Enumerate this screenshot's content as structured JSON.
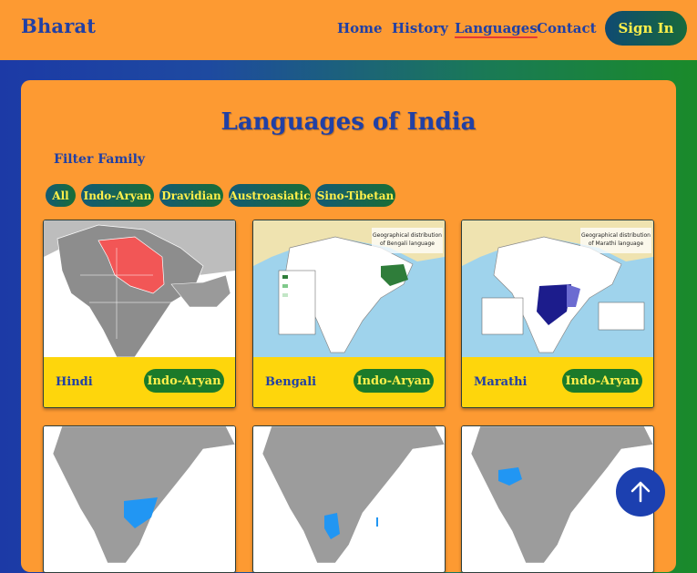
{
  "header": {
    "brand": "Bharat",
    "nav": [
      "Home",
      "History",
      "Languages",
      "Contact"
    ],
    "active_nav": "Languages",
    "sign_in": "Sign In"
  },
  "page": {
    "title": "Languages of India",
    "filter_label": "Filter Family",
    "filters": [
      "All",
      "Indo-Aryan",
      "Dravidian",
      "Austroasiatic",
      "Sino-Tibetan"
    ]
  },
  "cards": [
    {
      "name": "Hindi",
      "family": "Indo-Aryan",
      "map_caption": ""
    },
    {
      "name": "Bengali",
      "family": "Indo-Aryan",
      "map_caption": "Geographical distribution of Bengali language"
    },
    {
      "name": "Marathi",
      "family": "Indo-Aryan",
      "map_caption": "Geographical distribution of Marathi language"
    },
    {
      "name": "",
      "family": ""
    },
    {
      "name": "",
      "family": ""
    },
    {
      "name": "",
      "family": ""
    }
  ],
  "colors": {
    "header_bg": "#fd9a32",
    "brand_blue": "#2140a5",
    "badge_green": "#1b7a2a",
    "footer_yellow": "#fed60c",
    "chip_text": "#fff04a"
  },
  "icons": {
    "scroll_top": "arrow-up-icon"
  }
}
